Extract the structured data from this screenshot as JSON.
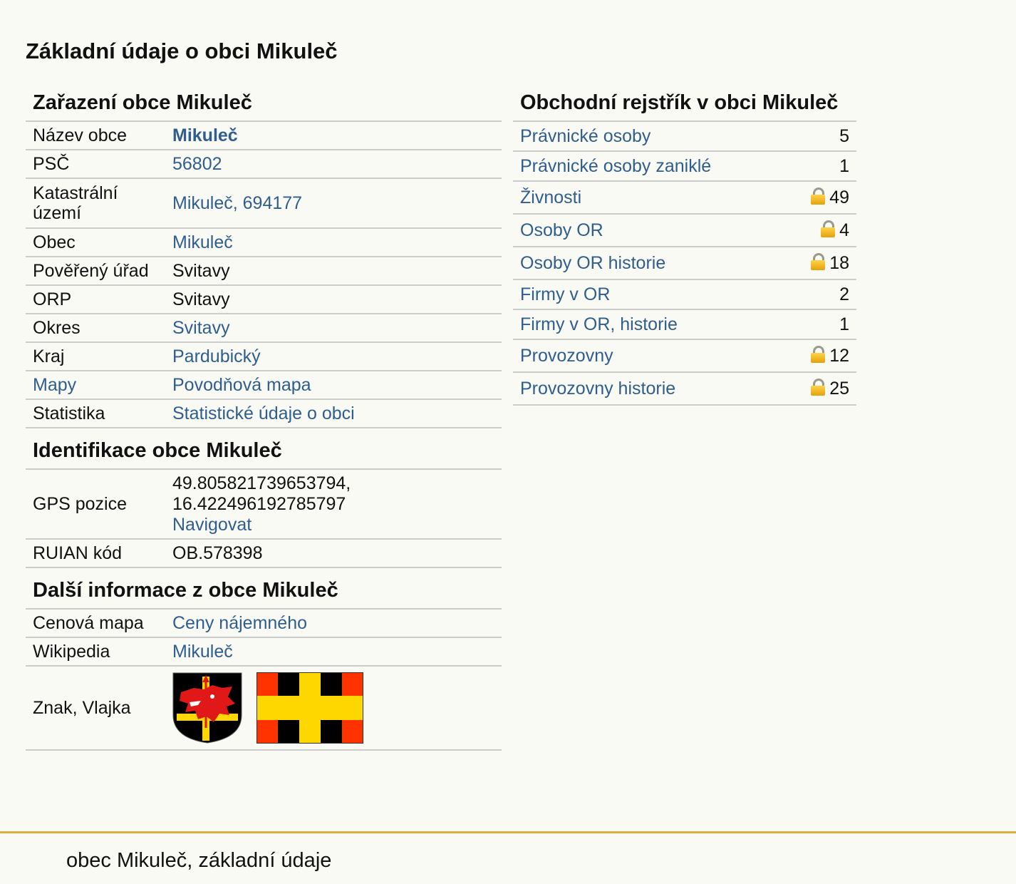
{
  "page_title": "Základní údaje o obci Mikuleč",
  "zarazeni": {
    "title": "Zařazení obce Mikuleč",
    "rows": [
      {
        "key": "Název obce",
        "value": "Mikuleč"
      },
      {
        "key": "PSČ",
        "value": "56802"
      },
      {
        "key": "Katastrální území",
        "value": "Mikuleč, 694177"
      },
      {
        "key": "Obec",
        "value": "Mikuleč"
      },
      {
        "key": "Pověřený úřad",
        "value": "Svitavy"
      },
      {
        "key": "ORP",
        "value": "Svitavy"
      },
      {
        "key": "Okres",
        "value": "Svitavy"
      },
      {
        "key": "Kraj",
        "value": "Pardubický"
      },
      {
        "key": "Mapy",
        "value": "Povodňová mapa"
      },
      {
        "key": "Statistika",
        "value": "Statistické údaje o obci"
      }
    ]
  },
  "identifikace": {
    "title": "Identifikace obce Mikuleč",
    "gps_label": "GPS pozice",
    "gps_lat": "49.805821739653794,",
    "gps_lon": "16.422496192785797",
    "navigate": "Navigovat",
    "ruian_label": "RUIAN kód",
    "ruian_value": "OB.578398"
  },
  "dalsi": {
    "title": "Další informace z obce Mikuleč",
    "cenova_label": "Cenová mapa",
    "cenova_value": "Ceny nájemného",
    "wiki_label": "Wikipedia",
    "wiki_value": "Mikuleč",
    "znak_label": "Znak, Vlajka"
  },
  "rejstrik": {
    "title": "Obchodní rejstřík v obci Mikuleč",
    "rows": [
      {
        "label": "Právnické osoby",
        "count": "5",
        "locked": false
      },
      {
        "label": "Právnické osoby zaniklé",
        "count": "1",
        "locked": false
      },
      {
        "label": "Živnosti",
        "count": "49",
        "locked": true
      },
      {
        "label": "Osoby OR",
        "count": "4",
        "locked": true
      },
      {
        "label": "Osoby OR historie",
        "count": "18",
        "locked": true
      },
      {
        "label": "Firmy v OR",
        "count": "2",
        "locked": false
      },
      {
        "label": "Firmy v OR, historie",
        "count": "1",
        "locked": false
      },
      {
        "label": "Provozovny",
        "count": "12",
        "locked": true
      },
      {
        "label": "Provozovny historie",
        "count": "25",
        "locked": true
      }
    ]
  },
  "footer": "obec Mikuleč, základní údaje",
  "icons": {
    "lock": "lock-icon",
    "coat_of_arms": "coat-of-arms",
    "flag": "flag"
  }
}
